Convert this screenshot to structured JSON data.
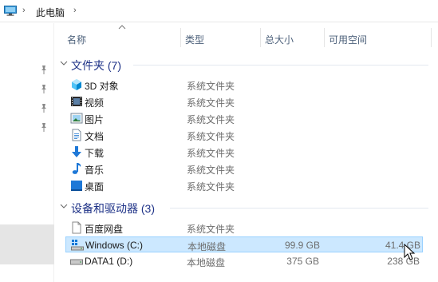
{
  "address": {
    "crumb": "此电脑"
  },
  "columns": {
    "name": "名称",
    "type": "类型",
    "total_size": "总大小",
    "free_space": "可用空间"
  },
  "groups": [
    {
      "label": "文件夹 (7)",
      "items": [
        {
          "name": "3D 对象",
          "type": "系统文件夹",
          "icon": "3d-objects-icon"
        },
        {
          "name": "视频",
          "type": "系统文件夹",
          "icon": "videos-icon"
        },
        {
          "name": "图片",
          "type": "系统文件夹",
          "icon": "pictures-icon"
        },
        {
          "name": "文档",
          "type": "系统文件夹",
          "icon": "documents-icon"
        },
        {
          "name": "下载",
          "type": "系统文件夹",
          "icon": "downloads-icon"
        },
        {
          "name": "音乐",
          "type": "系统文件夹",
          "icon": "music-icon"
        },
        {
          "name": "桌面",
          "type": "系统文件夹",
          "icon": "desktop-icon"
        }
      ]
    },
    {
      "label": "设备和驱动器 (3)",
      "items": [
        {
          "name": "百度网盘",
          "type": "系统文件夹",
          "total": "",
          "free": "",
          "icon": "baidu-netdisk-icon"
        },
        {
          "name": "Windows (C:)",
          "type": "本地磁盘",
          "total": "99.9 GB",
          "free": "41.4 GB",
          "icon": "windows-drive-icon",
          "selected": true
        },
        {
          "name": "DATA1 (D:)",
          "type": "本地磁盘",
          "total": "375 GB",
          "free": "238 GB",
          "icon": "drive-icon"
        }
      ]
    }
  ]
}
